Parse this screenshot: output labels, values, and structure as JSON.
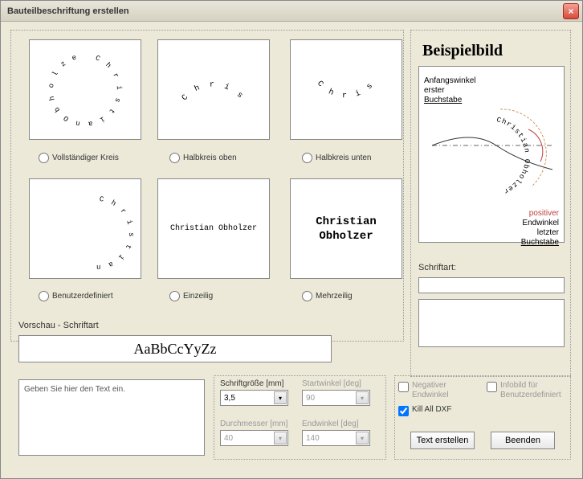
{
  "window": {
    "title": "Bauteilbeschriftung erstellen"
  },
  "options": {
    "full_circle": "Vollständiger Kreis",
    "half_top": "Halbkreis oben",
    "half_bottom": "Halbkreis unten",
    "user_defined": "Benutzerdefiniert",
    "single_line": "Einzeilig",
    "multi_line": "Mehrzeilig"
  },
  "thumbs": {
    "sample_name": "Christian",
    "sample_full": "Christian Obholzer",
    "line1": "Christian",
    "line2": "Obholzer"
  },
  "example": {
    "heading": "Beispielbild",
    "start_angle": "Anfangswinkel",
    "first": "erster",
    "letter": "Buchstabe",
    "positive": "positiver",
    "end_angle": "Endwinkel",
    "last": "letzter"
  },
  "font": {
    "label": "Schriftart:"
  },
  "preview": {
    "label": "Vorschau - Schriftart",
    "sample": "AaBbCcYyZz"
  },
  "textinput": {
    "placeholder": "Geben Sie hier den Text ein."
  },
  "fields": {
    "font_size": {
      "label": "Schriftgröße [mm]",
      "value": "3,5"
    },
    "start_angle": {
      "label": "Startwinkel [deg]",
      "value": "90"
    },
    "diameter": {
      "label": "Durchmesser [mm]",
      "value": "40"
    },
    "end_angle": {
      "label": "Endwinkel [deg]",
      "value": "140"
    }
  },
  "checks": {
    "neg_end": "Negativer\nEndwinkel",
    "info_ud": "Infobild für\nBenutzerdefiniert",
    "kill_dxf": "Kill All DXF"
  },
  "buttons": {
    "create": "Text erstellen",
    "close": "Beenden"
  }
}
